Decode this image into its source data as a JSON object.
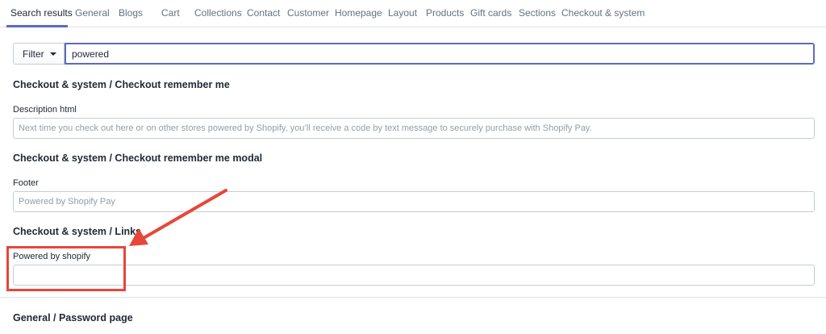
{
  "tabs": [
    {
      "label": "Search results",
      "active": true
    },
    {
      "label": "General"
    },
    {
      "label": "Blogs"
    },
    {
      "label": "Cart"
    },
    {
      "label": "Collections"
    },
    {
      "label": "Contact"
    },
    {
      "label": "Customer"
    },
    {
      "label": "Homepage"
    },
    {
      "label": "Layout"
    },
    {
      "label": "Products"
    },
    {
      "label": "Gift cards"
    },
    {
      "label": "Sections"
    },
    {
      "label": "Checkout & system"
    }
  ],
  "filter": {
    "label": "Filter",
    "icon": "caret-down-icon"
  },
  "search": {
    "value": "powered"
  },
  "sections": [
    {
      "title": "Checkout & system / Checkout remember me",
      "field_label": "Description html",
      "placeholder": "Next time you check out here or on other stores powered by Shopify, you’ll receive a code by text message to securely purchase with Shopify Pay."
    },
    {
      "title": "Checkout & system / Checkout remember me modal",
      "field_label": "Footer",
      "placeholder": "Powered by Shopify Pay"
    },
    {
      "title": "Checkout & system / Links",
      "field_label": "Powered by shopify",
      "placeholder": ""
    },
    {
      "title": "General / Password page"
    }
  ],
  "annotation": {
    "color": "#e8463a"
  },
  "colors": {
    "accent": "#5c6ac4",
    "text": "#212b36",
    "muted": "#637381",
    "border": "#c4cdd5"
  }
}
